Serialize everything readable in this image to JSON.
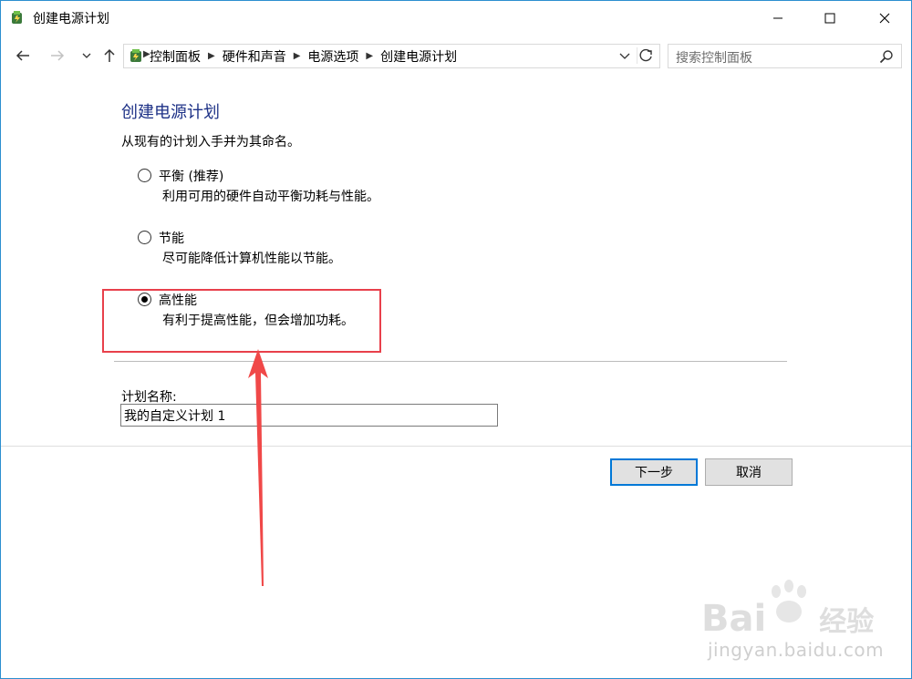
{
  "window": {
    "title": "创建电源计划",
    "controls": {
      "minimize": "minimize-icon",
      "maximize": "maximize-icon",
      "close": "close-icon"
    }
  },
  "address_bar": {
    "breadcrumbs": [
      "控制面板",
      "硬件和声音",
      "电源选项",
      "创建电源计划"
    ],
    "search_placeholder": "搜索控制面板"
  },
  "main": {
    "title": "创建电源计划",
    "instruction": "从现有的计划入手并为其命名。",
    "options": [
      {
        "label": "平衡 (推荐)",
        "description": "利用可用的硬件自动平衡功耗与性能。",
        "selected": false
      },
      {
        "label": "节能",
        "description": "尽可能降低计算机性能以节能。",
        "selected": false
      },
      {
        "label": "高性能",
        "description": "有利于提高性能，但会增加功耗。",
        "selected": true
      }
    ],
    "plan_name_label": "计划名称:",
    "plan_name_value": "我的自定义计划 1"
  },
  "buttons": {
    "next": "下一步",
    "cancel": "取消"
  },
  "annotation": {
    "color": "#e8404b"
  },
  "watermark": {
    "brand": "Bai",
    "brand2": "经验",
    "url": "jingyan.baidu.com"
  },
  "colors": {
    "title_blue": "#1e3287",
    "accent": "#0078d7",
    "border": "#2b8fd0"
  }
}
